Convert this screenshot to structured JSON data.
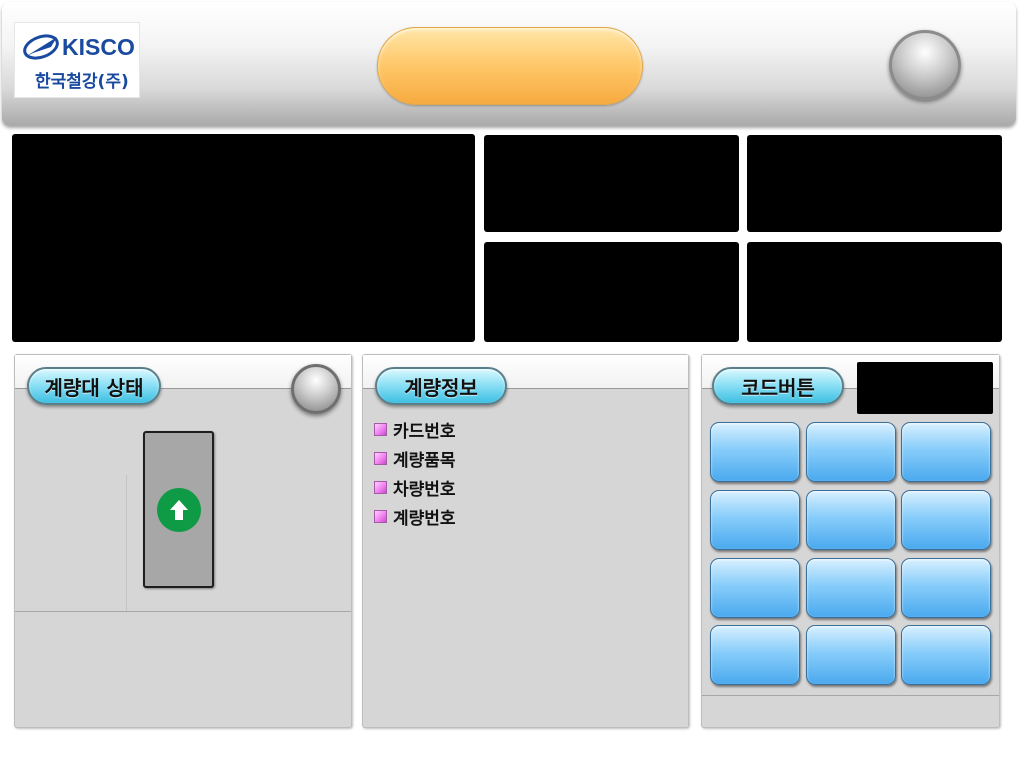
{
  "header": {
    "logo_name": "KISCO",
    "logo_subtitle": "한국철강(주)"
  },
  "status_panel": {
    "title": "계량대 상태",
    "direction_icon": "arrow-up-icon"
  },
  "info_panel": {
    "title": "계량정보",
    "items": [
      "카드번호",
      "계량품목",
      "차량번호",
      "계량번호"
    ]
  },
  "code_panel": {
    "title": "코드버튼"
  },
  "colors": {
    "accent_orange": "#ffc768",
    "title_cyan": "#3dbfe2",
    "key_blue": "#4aa9ee",
    "arrow_green": "#0f9a46",
    "bullet_pink": "#f07bf0"
  }
}
